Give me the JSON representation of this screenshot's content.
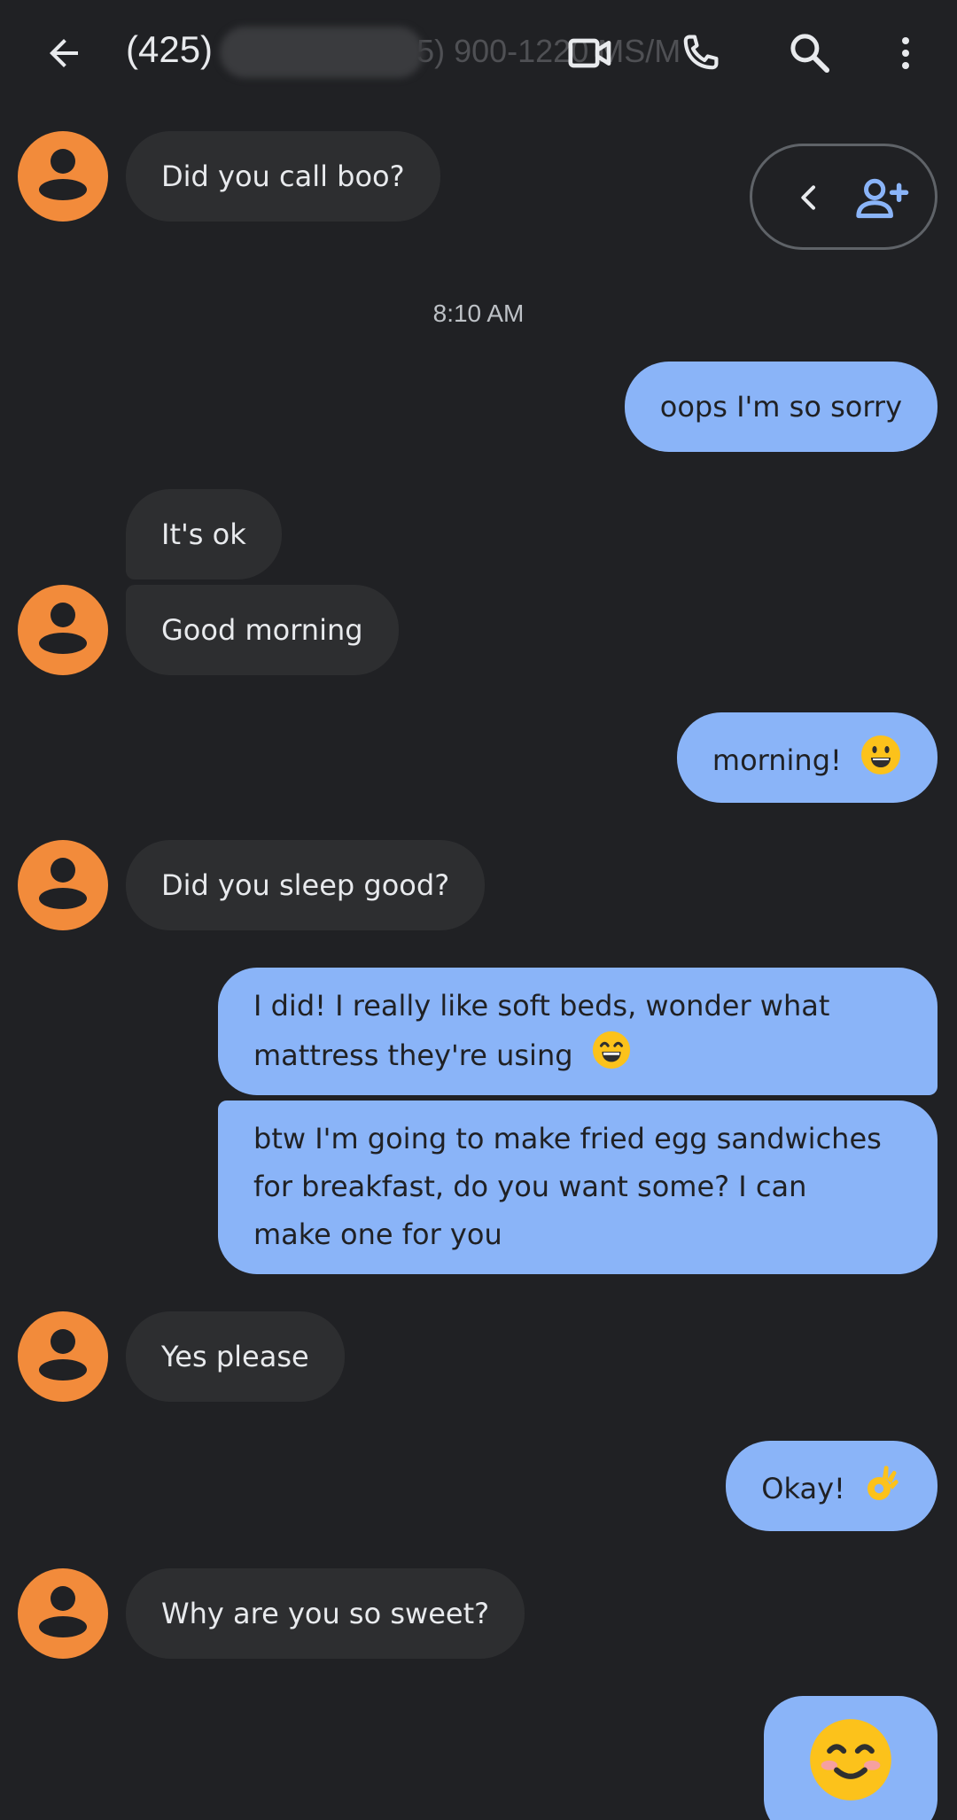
{
  "header": {
    "title_visible": "(425)",
    "title_faded": "5) 900-1220 MS/M",
    "actions": [
      "video-call",
      "phone-call",
      "search",
      "more-options"
    ]
  },
  "timestamp": "8:10 AM",
  "messages": [
    {
      "sender": "them",
      "text": "Did you call boo?"
    },
    {
      "sender": "me",
      "text": "oops I'm so sorry"
    },
    {
      "sender": "them",
      "text": "It's ok"
    },
    {
      "sender": "them",
      "text": "Good morning"
    },
    {
      "sender": "me",
      "text": "morning!",
      "emoji": "grinning-face"
    },
    {
      "sender": "them",
      "text": "Did you sleep good?"
    },
    {
      "sender": "me",
      "text_line1": "I did! I really like soft beds, wonder what",
      "text_line2": "mattress they're using",
      "emoji": "grinning-face-smiling-eyes"
    },
    {
      "sender": "me",
      "text_line1": "btw I'm going to make fried egg sandwiches",
      "text_line2": "for breakfast, do you want some? I can",
      "text_line3": "make one for you"
    },
    {
      "sender": "them",
      "text": "Yes please"
    },
    {
      "sender": "me",
      "text": "Okay!",
      "emoji": "ok-hand"
    },
    {
      "sender": "them",
      "text": "Why are you so sweet?"
    },
    {
      "sender": "me",
      "emoji": "smiling-face-blushing"
    }
  ],
  "colors": {
    "background": "#202124",
    "incoming_bubble": "#2d2e30",
    "outgoing_bubble": "#8ab4f8",
    "avatar": "#f28b3b",
    "icon": "#e8eaed",
    "accent_icon": "#8ab4f8"
  }
}
